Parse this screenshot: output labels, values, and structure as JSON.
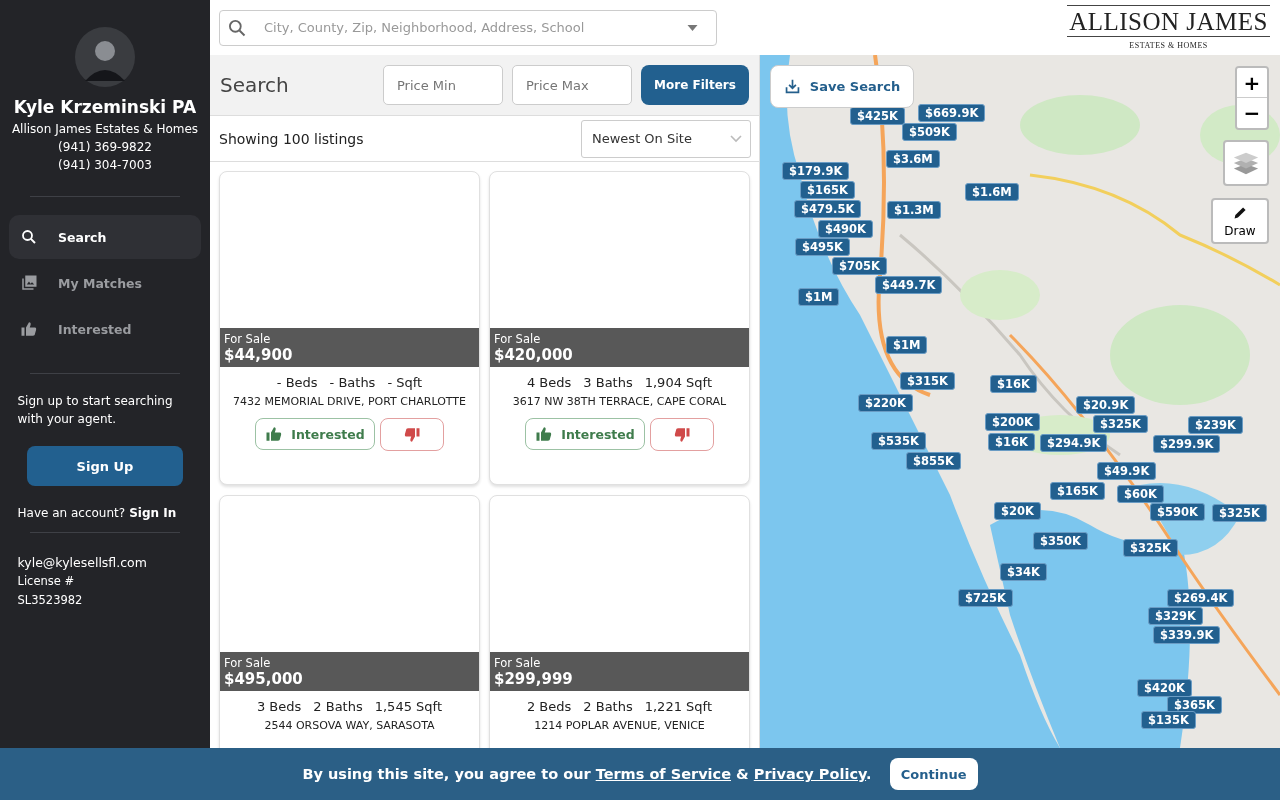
{
  "agent": {
    "name": "Kyle Krzeminski PA",
    "company": "Allison James Estates & Homes",
    "phones": [
      "(941) 369-9822",
      "(941) 304-7003"
    ],
    "email": "kyle@kylesellsfl.com",
    "license_label": "License #",
    "license": "SL3523982"
  },
  "nav": [
    {
      "label": "Search",
      "selected": true
    },
    {
      "label": "My Matches",
      "selected": false
    },
    {
      "label": "Interested",
      "selected": false
    }
  ],
  "signup": {
    "text": "Sign up to start searching with your agent.",
    "button": "Sign Up",
    "account_text": "Have an account?",
    "sign_in": "Sign In"
  },
  "search": {
    "placeholder": "City, County, Zip, Neighborhood, Address, School"
  },
  "logo": {
    "name": "ALLISON JAMES",
    "tagline": "ESTATES & HOMES"
  },
  "filters": {
    "title": "Search",
    "price_min": {
      "placeholder": "Price Min"
    },
    "price_max": {
      "placeholder": "Price Max"
    },
    "more": "More Filters"
  },
  "results": {
    "count": "Showing 100 listings",
    "sort": "Newest On Site"
  },
  "listings": [
    {
      "status": "For Sale",
      "price": "$44,900",
      "beds": "- Beds",
      "baths": "- Baths",
      "sqft": "- Sqft",
      "address": "7432 MEMORIAL DRIVE, PORT CHARLOTTE",
      "interested": "Interested"
    },
    {
      "status": "For Sale",
      "price": "$420,000",
      "beds": "4 Beds",
      "baths": "3 Baths",
      "sqft": "1,904 Sqft",
      "address": "3617 NW 38TH TERRACE, CAPE CORAL",
      "interested": "Interested"
    },
    {
      "status": "For Sale",
      "price": "$495,000",
      "beds": "3 Beds",
      "baths": "2 Baths",
      "sqft": "1,545 Sqft",
      "address": "2544 ORSOVA WAY, SARASOTA"
    },
    {
      "status": "For Sale",
      "price": "$299,999",
      "beds": "2 Beds",
      "baths": "2 Baths",
      "sqft": "1,221 Sqft",
      "address": "1214 POPLAR AVENUE, VENICE"
    }
  ],
  "map": {
    "save_search": "Save Search",
    "zoom_in": "+",
    "zoom_out": "−",
    "draw": "Draw",
    "pins": [
      "$669.9K",
      "$425K",
      "$509K",
      "$3.6M",
      "$179.9K",
      "$165K",
      "$1.6M",
      "$479.5K",
      "$1.3M",
      "$490K",
      "$495K",
      "$705K",
      "$449.7K",
      "$1M",
      "$1M",
      "$315K",
      "$16K",
      "$220K",
      "$20.9K",
      "$200K",
      "$325K",
      "$239K",
      "$535K",
      "$16K",
      "$294.9K",
      "$299.9K",
      "$855K",
      "$49.9K",
      "$165K",
      "$60K",
      "$20K",
      "$590K",
      "$325K",
      "$350K",
      "$325K",
      "$34K",
      "$725K",
      "$269.4K",
      "$329K",
      "$339.9K",
      "$420K",
      "$365K",
      "$135K"
    ]
  },
  "cookie": {
    "text_before": "By using this site, you agree to our",
    "terms": "Terms of Service",
    "amp": "&",
    "privacy": "Privacy Policy",
    "end": ".",
    "button": "Continue"
  }
}
